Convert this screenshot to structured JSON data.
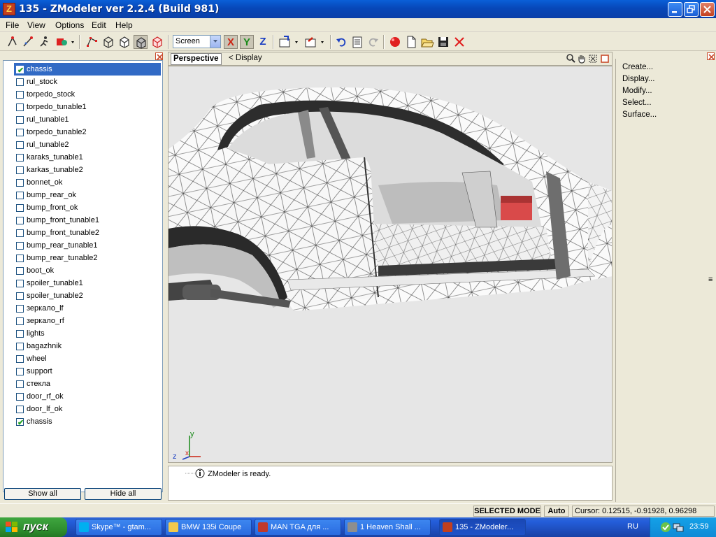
{
  "window": {
    "title": "135 - ZModeler ver 2.2.4 (Build 981)",
    "icon_letter": "Z"
  },
  "menu": [
    "File",
    "View",
    "Options",
    "Edit",
    "Help"
  ],
  "toolbar": {
    "screen_select": "Screen",
    "axis_x": "X",
    "axis_y": "Y",
    "axis_z": "Z"
  },
  "objects": [
    {
      "name": "chassis",
      "checked": true,
      "selected": true
    },
    {
      "name": "rul_stock",
      "checked": false
    },
    {
      "name": "torpedo_stock",
      "checked": false
    },
    {
      "name": "torpedo_tunable1",
      "checked": false
    },
    {
      "name": "rul_tunable1",
      "checked": false
    },
    {
      "name": "torpedo_tunable2",
      "checked": false
    },
    {
      "name": "rul_tunable2",
      "checked": false
    },
    {
      "name": "karaks_tunable1",
      "checked": false
    },
    {
      "name": "karkas_tunable2",
      "checked": false
    },
    {
      "name": "bonnet_ok",
      "checked": false
    },
    {
      "name": "bump_rear_ok",
      "checked": false
    },
    {
      "name": "bump_front_ok",
      "checked": false
    },
    {
      "name": "bump_front_tunable1",
      "checked": false
    },
    {
      "name": "bump_front_tunable2",
      "checked": false
    },
    {
      "name": "bump_rear_tunable1",
      "checked": false
    },
    {
      "name": "bump_rear_tunable2",
      "checked": false
    },
    {
      "name": "boot_ok",
      "checked": false
    },
    {
      "name": "spoiler_tunable1",
      "checked": false
    },
    {
      "name": "spoiler_tunable2",
      "checked": false
    },
    {
      "name": "зеркало_lf",
      "checked": false
    },
    {
      "name": "зеркало_rf",
      "checked": false
    },
    {
      "name": "lights",
      "checked": false
    },
    {
      "name": "bagazhnik",
      "checked": false
    },
    {
      "name": "wheel",
      "checked": false
    },
    {
      "name": "support",
      "checked": false
    },
    {
      "name": "стекла",
      "checked": false
    },
    {
      "name": "door_rf_ok",
      "checked": false
    },
    {
      "name": "door_lf_ok",
      "checked": false
    },
    {
      "name": "chassis",
      "checked": true
    }
  ],
  "left_panel": {
    "show_all": "Show all",
    "hide_all": "Hide all"
  },
  "viewport": {
    "tab": "Perspective",
    "display_label": "<  Display",
    "axis_z": "z",
    "axis_y": "y",
    "axis_x": "x"
  },
  "right_panel": {
    "items": [
      "Create...",
      "Display...",
      "Modify...",
      "Select...",
      "Surface..."
    ]
  },
  "log": {
    "message": "ZModeler is ready."
  },
  "statusbar": {
    "mode": "SELECTED MODE",
    "auto": "Auto",
    "cursor": "Cursor: 0.12515, -0.91928, 0.96298"
  },
  "taskbar": {
    "start": "пуск",
    "tasks": [
      {
        "label": "Skype™ - gtam...",
        "color": "#00aff0"
      },
      {
        "label": "BMW 135i Coupe",
        "color": "#f2c94c"
      },
      {
        "label": "MAN TGA для ...",
        "color": "#c0392b"
      },
      {
        "label": "1 Heaven Shall ...",
        "color": "#8e8e8e"
      },
      {
        "label": "135 - ZModeler...",
        "color": "#c23f1f",
        "active": true
      }
    ],
    "lang": "RU",
    "clock": "23:59"
  }
}
